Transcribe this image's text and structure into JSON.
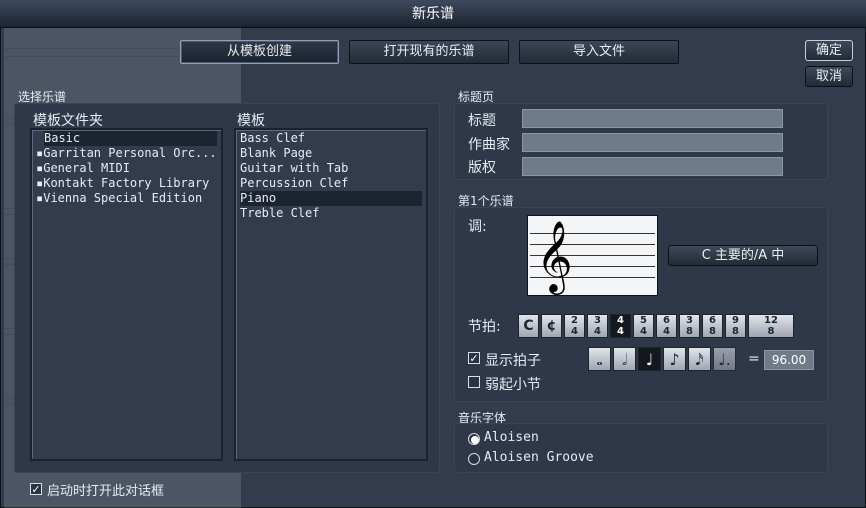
{
  "window": {
    "title": "新乐谱"
  },
  "top_tabs": [
    "从模板创建",
    "打开现有的乐谱",
    "导入文件"
  ],
  "buttons": {
    "ok": "确定",
    "cancel": "取消"
  },
  "choose": {
    "group_label": "选择乐谱",
    "folders_label": "模板文件夹",
    "folders": [
      "Basic",
      "Garritan Personal Orc...",
      "General MIDI",
      "Kontakt Factory Library",
      "Vienna Special Edition"
    ],
    "selected_folder": "Basic",
    "templates_label": "模板",
    "templates": [
      "Bass Clef",
      "Blank Page",
      "Guitar with Tab",
      "Percussion Clef",
      "Piano",
      "Treble Clef"
    ],
    "selected_template": "Piano"
  },
  "title_page": {
    "label": "标题页",
    "fields": [
      {
        "label": "标题",
        "value": ""
      },
      {
        "label": "作曲家",
        "value": ""
      },
      {
        "label": "版权",
        "value": ""
      }
    ]
  },
  "first_staff": {
    "label": "第1个乐谱",
    "key_label": "调:",
    "clef_glyph": "𝄞",
    "key_value": "C 主要的/A 中",
    "time_label": "节拍:",
    "time_signatures": [
      "C",
      "¢",
      "2/4",
      "3/4",
      "4/4",
      "5/4",
      "6/4",
      "3/8",
      "6/8",
      "9/8",
      "12/8"
    ],
    "time_selected": "4/4",
    "show_beat_label": "显示拍子",
    "show_beat_checked": true,
    "note_values": [
      "whole",
      "half",
      "quarter",
      "eighth",
      "sixteenth",
      "dotted"
    ],
    "note_glyphs": [
      "𝅝",
      "𝅗𝅥",
      "♩",
      "♪",
      "𝅘𝅥𝅯",
      "♩."
    ],
    "note_selected": "quarter",
    "equals": "=",
    "tempo": "96.00",
    "pickup_label": "弱起小节",
    "pickup_checked": false
  },
  "music_font": {
    "label": "音乐字体",
    "options": [
      "Aloisen",
      "Aloisen Groove"
    ],
    "selected": "Aloisen"
  },
  "startup": {
    "label": "启动时打开此对话框",
    "checked": true
  }
}
